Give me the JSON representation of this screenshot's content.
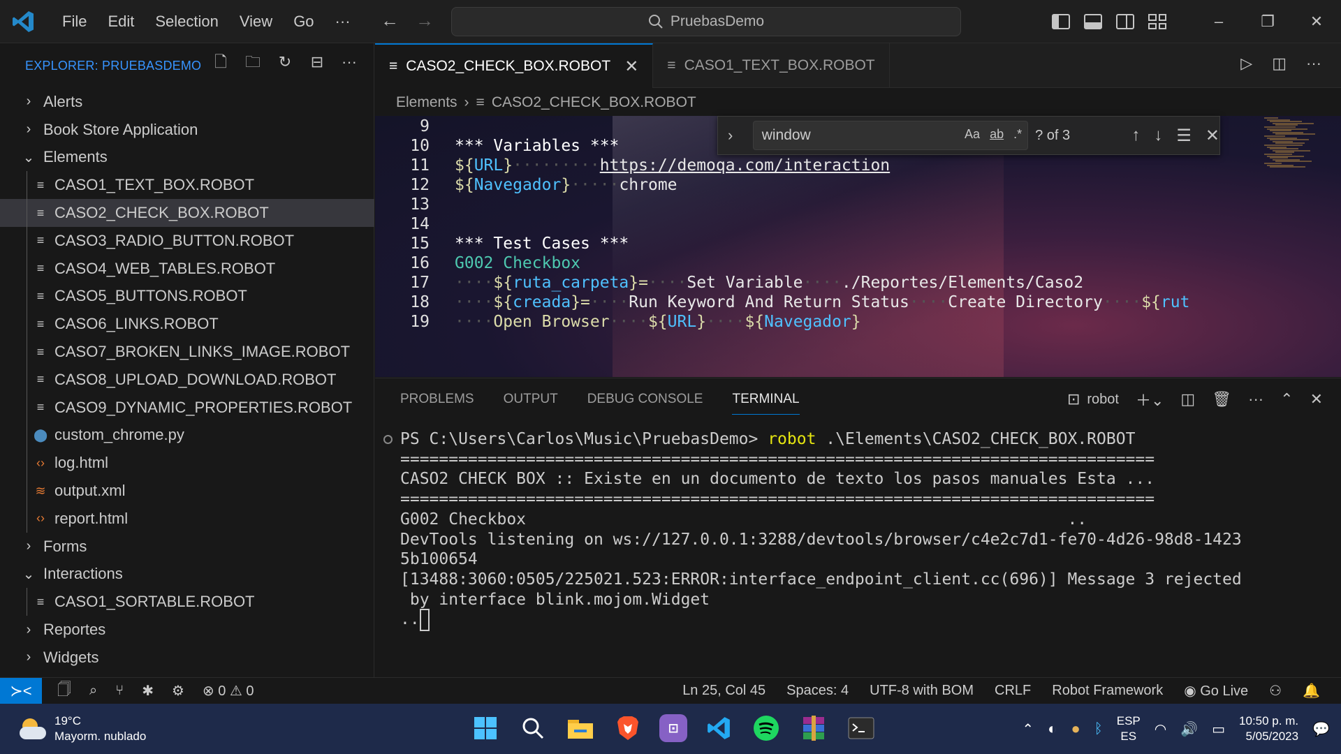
{
  "titlebar": {
    "menu": [
      "File",
      "Edit",
      "Selection",
      "View",
      "Go",
      "···"
    ],
    "search_text": "PruebasDemo",
    "window_buttons": [
      "–",
      "❐",
      "✕"
    ]
  },
  "sidebar": {
    "title": "EXPLORER: PRUEBASDEMO",
    "tree": [
      {
        "label": "Alerts",
        "type": "folder",
        "expanded": false
      },
      {
        "label": "Book Store Application",
        "type": "folder",
        "expanded": false
      },
      {
        "label": "Elements",
        "type": "folder",
        "expanded": true
      },
      {
        "label": "CASO1_TEXT_BOX.ROBOT",
        "type": "file"
      },
      {
        "label": "CASO2_CHECK_BOX.ROBOT",
        "type": "file",
        "selected": true
      },
      {
        "label": "CASO3_RADIO_BUTTON.ROBOT",
        "type": "file"
      },
      {
        "label": "CASO4_WEB_TABLES.ROBOT",
        "type": "file"
      },
      {
        "label": "CASO5_BUTTONS.ROBOT",
        "type": "file"
      },
      {
        "label": "CASO6_LINKS.ROBOT",
        "type": "file"
      },
      {
        "label": "CASO7_BROKEN_LINKS_IMAGE.ROBOT",
        "type": "file"
      },
      {
        "label": "CASO8_UPLOAD_DOWNLOAD.ROBOT",
        "type": "file"
      },
      {
        "label": "CASO9_DYNAMIC_PROPERTIES.ROBOT",
        "type": "file"
      },
      {
        "label": "custom_chrome.py",
        "type": "file",
        "icon": "python"
      },
      {
        "label": "log.html",
        "type": "file",
        "icon": "html"
      },
      {
        "label": "output.xml",
        "type": "file",
        "icon": "xml"
      },
      {
        "label": "report.html",
        "type": "file",
        "icon": "html"
      },
      {
        "label": "Forms",
        "type": "folder",
        "expanded": false
      },
      {
        "label": "Interactions",
        "type": "folder",
        "expanded": true
      },
      {
        "label": "CASO1_SORTABLE.ROBOT",
        "type": "file"
      },
      {
        "label": "Reportes",
        "type": "folder",
        "expanded": false
      },
      {
        "label": "Widgets",
        "type": "folder",
        "expanded": false
      }
    ]
  },
  "tabs": [
    {
      "label": "CASO2_CHECK_BOX.ROBOT",
      "active": true,
      "close": "✕"
    },
    {
      "label": "CASO1_TEXT_BOX.ROBOT",
      "active": false
    }
  ],
  "breadcrumb": {
    "folder": "Elements",
    "file": "CASO2_CHECK_BOX.ROBOT"
  },
  "find": {
    "query": "window",
    "match_case": "Aa",
    "whole_word": "ab",
    "regex": ".*",
    "count": "? of 3"
  },
  "code_lines": [
    {
      "n": "9",
      "segments": []
    },
    {
      "n": "10",
      "segments": [
        {
          "t": "*** Variables ***",
          "c": "kw"
        }
      ]
    },
    {
      "n": "11",
      "segments": [
        {
          "t": "${",
          "c": "var"
        },
        {
          "t": "URL",
          "c": "vn"
        },
        {
          "t": "}",
          "c": "var"
        },
        {
          "t": "·········",
          "c": "dots"
        },
        {
          "t": "https://demoqa.com/interaction",
          "c": "link"
        }
      ]
    },
    {
      "n": "12",
      "segments": [
        {
          "t": "${",
          "c": "var"
        },
        {
          "t": "Navegador",
          "c": "vn"
        },
        {
          "t": "}",
          "c": "var"
        },
        {
          "t": "·····",
          "c": "dots"
        },
        {
          "t": "chrome",
          "c": ""
        }
      ]
    },
    {
      "n": "13",
      "segments": []
    },
    {
      "n": "14",
      "segments": []
    },
    {
      "n": "15",
      "segments": [
        {
          "t": "*** Test Cases ***",
          "c": "kw"
        }
      ]
    },
    {
      "n": "16",
      "segments": [
        {
          "t": "G002 Checkbox",
          "c": "tcname"
        }
      ]
    },
    {
      "n": "17",
      "segments": [
        {
          "t": "····",
          "c": "dots"
        },
        {
          "t": "${",
          "c": "var"
        },
        {
          "t": "ruta_carpeta",
          "c": "vn"
        },
        {
          "t": "}=",
          "c": "var"
        },
        {
          "t": "····",
          "c": "dots"
        },
        {
          "t": "Set Variable",
          "c": ""
        },
        {
          "t": "····",
          "c": "dots"
        },
        {
          "t": "./Reportes/Elements/Caso2",
          "c": ""
        }
      ]
    },
    {
      "n": "18",
      "segments": [
        {
          "t": "····",
          "c": "dots"
        },
        {
          "t": "${",
          "c": "var"
        },
        {
          "t": "creada",
          "c": "vn"
        },
        {
          "t": "}=",
          "c": "var"
        },
        {
          "t": "····",
          "c": "dots"
        },
        {
          "t": "Run Keyword And Return Status",
          "c": ""
        },
        {
          "t": "····",
          "c": "dots"
        },
        {
          "t": "Create Directory",
          "c": ""
        },
        {
          "t": "····",
          "c": "dots"
        },
        {
          "t": "${",
          "c": "var"
        },
        {
          "t": "rut",
          "c": "vn"
        }
      ]
    },
    {
      "n": "19",
      "segments": [
        {
          "t": "····",
          "c": "dots"
        },
        {
          "t": "Open Browser",
          "c": "var"
        },
        {
          "t": "····",
          "c": "dots"
        },
        {
          "t": "${",
          "c": "var"
        },
        {
          "t": "URL",
          "c": "vn"
        },
        {
          "t": "}",
          "c": "var"
        },
        {
          "t": "····",
          "c": "dots"
        },
        {
          "t": "${",
          "c": "var"
        },
        {
          "t": "Navegador",
          "c": "vn"
        },
        {
          "t": "}",
          "c": "var"
        }
      ]
    }
  ],
  "panel": {
    "tabs": [
      "PROBLEMS",
      "OUTPUT",
      "DEBUG CONSOLE",
      "TERMINAL"
    ],
    "active_tab": "TERMINAL",
    "terminal_name": "robot",
    "terminal": {
      "prompt": "PS C:\\Users\\Carlos\\Music\\PruebasDemo> ",
      "command": "robot",
      "args": " .\\Elements\\CASO2_CHECK_BOX.ROBOT",
      "lines": [
        "==============================================================================",
        "CASO2 CHECK BOX :: Existe en un documento de texto los pasos manuales Esta ...",
        "==============================================================================",
        "G002 Checkbox                                                        ..",
        "DevTools listening on ws://127.0.0.1:3288/devtools/browser/c4e2c7d1-fe70-4d26-98d8-1423",
        "5b100654",
        "[13488:3060:0505/225021.523:ERROR:interface_endpoint_client.cc(696)] Message 3 rejected",
        " by interface blink.mojom.Widget",
        ".."
      ]
    }
  },
  "statusbar": {
    "errors": "0",
    "warnings": "0",
    "position": "Ln 25, Col 45",
    "spaces": "Spaces: 4",
    "encoding": "UTF-8 with BOM",
    "eol": "CRLF",
    "language": "Robot Framework",
    "golive": "Go Live"
  },
  "taskbar": {
    "temperature": "19°C",
    "weather": "Mayorm. nublado",
    "lang1": "ESP",
    "lang2": "ES",
    "time": "10:50 p. m.",
    "date": "5/05/2023"
  },
  "colors": {
    "accent": "#0078d4",
    "statusbar_remote": "#0078d4",
    "taskbar": "#1e2a4a"
  }
}
